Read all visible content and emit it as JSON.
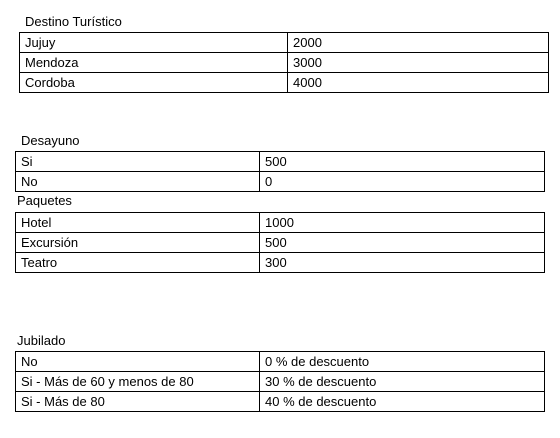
{
  "destino": {
    "title": "Destino Turístico",
    "rows": [
      {
        "label": "Jujuy",
        "value": "2000"
      },
      {
        "label": "Mendoza",
        "value": "3000"
      },
      {
        "label": "Cordoba",
        "value": "4000"
      }
    ]
  },
  "desayuno": {
    "title": "Desayuno",
    "rows": [
      {
        "label": "Si",
        "value": "500"
      },
      {
        "label": "No",
        "value": "0"
      }
    ]
  },
  "paquetes": {
    "title": "Paquetes",
    "rows": [
      {
        "label": "Hotel",
        "value": "1000"
      },
      {
        "label": "Excursión",
        "value": "500"
      },
      {
        "label": "Teatro",
        "value": "300"
      }
    ]
  },
  "jubilado": {
    "title": "Jubilado",
    "rows": [
      {
        "label": "No",
        "value": "0 % de descuento"
      },
      {
        "label": "Si - Más de 60 y menos de 80",
        "value": "30 % de descuento"
      },
      {
        "label": "Si -  Más de 80",
        "value": "40 % de descuento"
      }
    ]
  }
}
